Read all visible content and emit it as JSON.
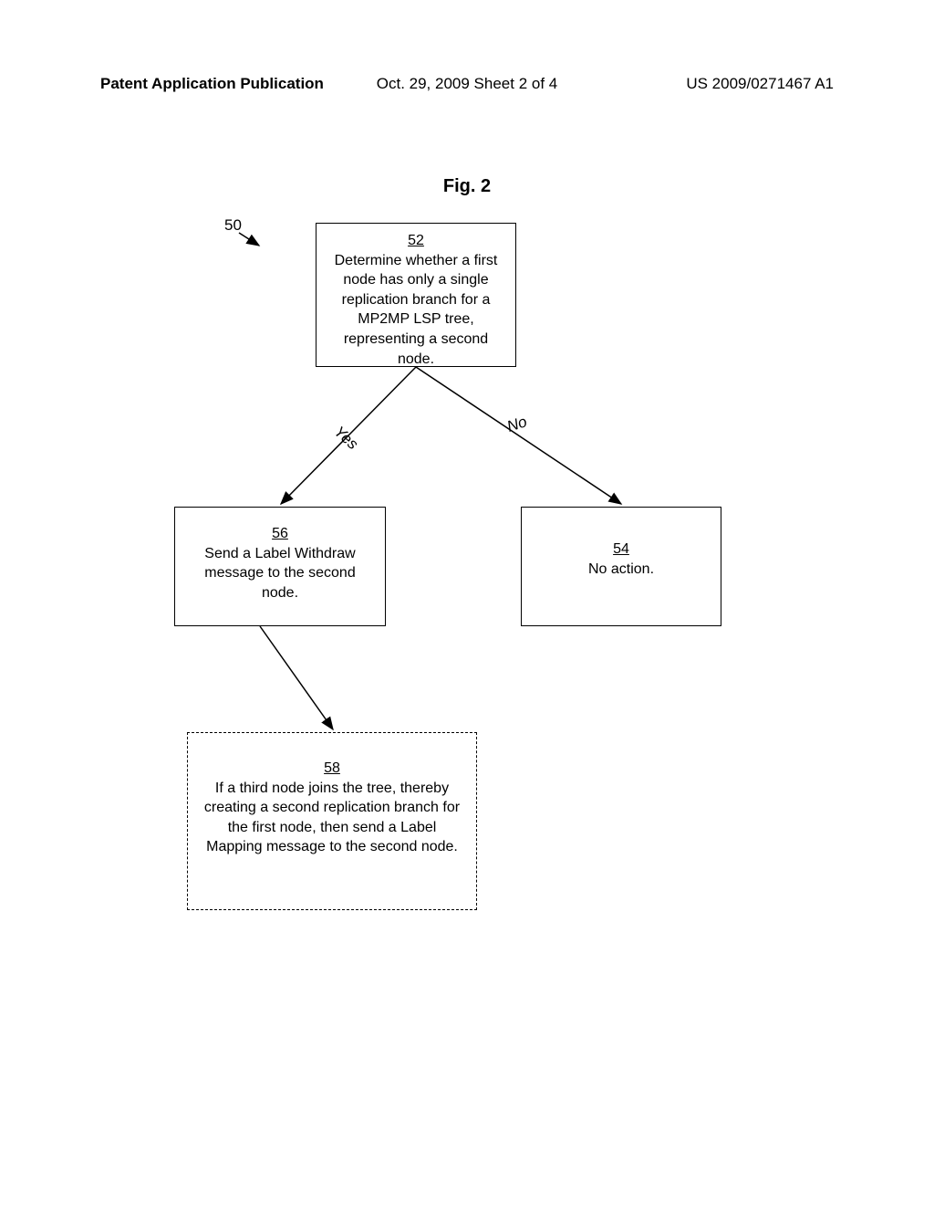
{
  "header": {
    "left": "Patent Application Publication",
    "center": "Oct. 29, 2009  Sheet 2 of 4",
    "right": "US 2009/0271467 A1"
  },
  "figure": {
    "title": "Fig. 2",
    "ref_label": "50"
  },
  "boxes": {
    "b52": {
      "num": "52",
      "text": "Determine whether a first node has only a single replication branch for a MP2MP LSP tree, representing a second node."
    },
    "b56": {
      "num": "56",
      "text": "Send a Label Withdraw message to the second node."
    },
    "b54": {
      "num": "54",
      "text": "No action."
    },
    "b58": {
      "num": "58",
      "text": "If a third node joins the tree, thereby creating a second replication branch for the first node, then send a Label Mapping message to the second node."
    }
  },
  "edges": {
    "yes": "Yes",
    "no": "No"
  }
}
